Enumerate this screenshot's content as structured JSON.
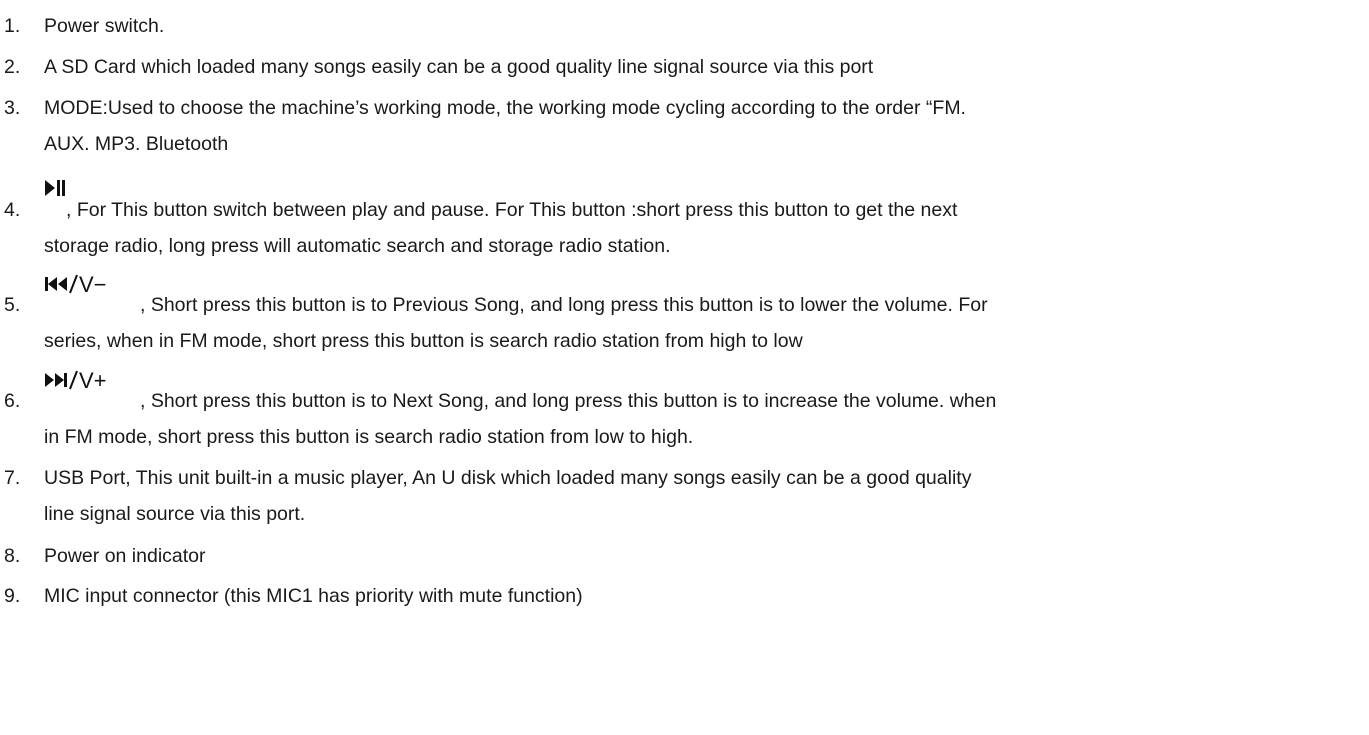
{
  "items": [
    {
      "number": "1.",
      "lines": [
        "Power switch."
      ]
    },
    {
      "number": "2.",
      "lines": [
        "A SD Card which loaded many songs easily can be a good quality line signal source via this port"
      ]
    },
    {
      "number": "3.",
      "lines": [
        "MODE:Used to choose the machine’s working mode, the working mode cycling according to the order “FM.",
        "AUX. MP3. Bluetooth"
      ]
    },
    {
      "number": "4.",
      "icon": "play-pause-icon",
      "lines": [
        ", For This button switch between play and pause. For This button :short press this button to get the next",
        "storage radio, long press will automatic search and storage radio station."
      ]
    },
    {
      "number": "5.",
      "icon": "previous-volume-down-icon",
      "icon_label": "V−",
      "lines": [
        ", Short press this button is to Previous Song, and long press this button is to lower the volume. For",
        "series, when in FM mode, short press this button is search radio station from high to low"
      ]
    },
    {
      "number": "6.",
      "icon": "next-volume-up-icon",
      "icon_label": "V+",
      "lines": [
        ", Short press this button is to Next Song, and long press this button is to increase the volume. when",
        "in FM mode, short press this button is search radio station from low to high."
      ]
    },
    {
      "number": "7.",
      "lines": [
        "USB Port, This unit built-in a music player, An U disk which loaded many songs easily can be a good quality",
        "line signal source via this port."
      ]
    },
    {
      "number": "8.",
      "lines": [
        "Power on indicator"
      ]
    },
    {
      "number": "9.",
      "lines": [
        "MIC input connector (this MIC1 has priority with mute function)"
      ]
    }
  ]
}
